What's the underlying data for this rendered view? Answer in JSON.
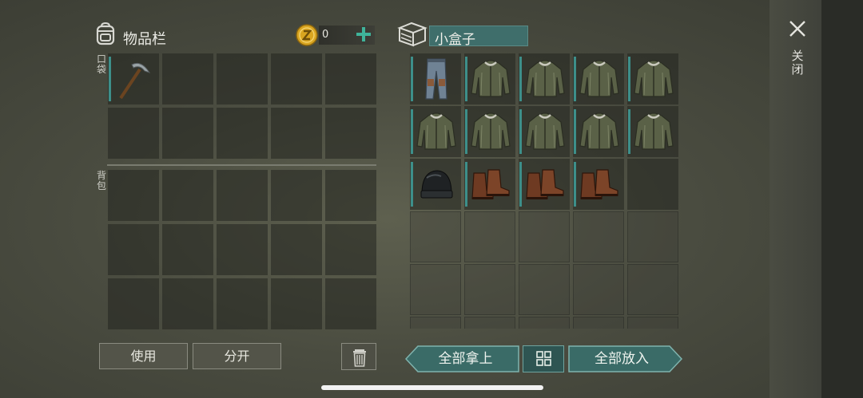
{
  "inventory": {
    "title": "物品栏",
    "coins": "0",
    "pocket_label": "口袋",
    "backpack_label": "背包",
    "pocket_items": [
      "pickaxe-icon"
    ],
    "use_label": "使用",
    "split_label": "分开"
  },
  "container": {
    "title": "小盒子",
    "items": [
      "pants-icon",
      "jacket-icon",
      "jacket-icon",
      "jacket-icon",
      "jacket-icon",
      "jacket-icon",
      "jacket-icon",
      "jacket-icon",
      "jacket-icon",
      "jacket-icon",
      "beanie-icon",
      "boots-icon",
      "boots-icon",
      "boots-icon"
    ],
    "take_all_label": "全部拿上",
    "put_all_label": "全部放入"
  },
  "close_label": "关闭",
  "colors": {
    "accent": "#3d8f8a",
    "coin": "#d9a520",
    "plus": "#3fb39a"
  }
}
